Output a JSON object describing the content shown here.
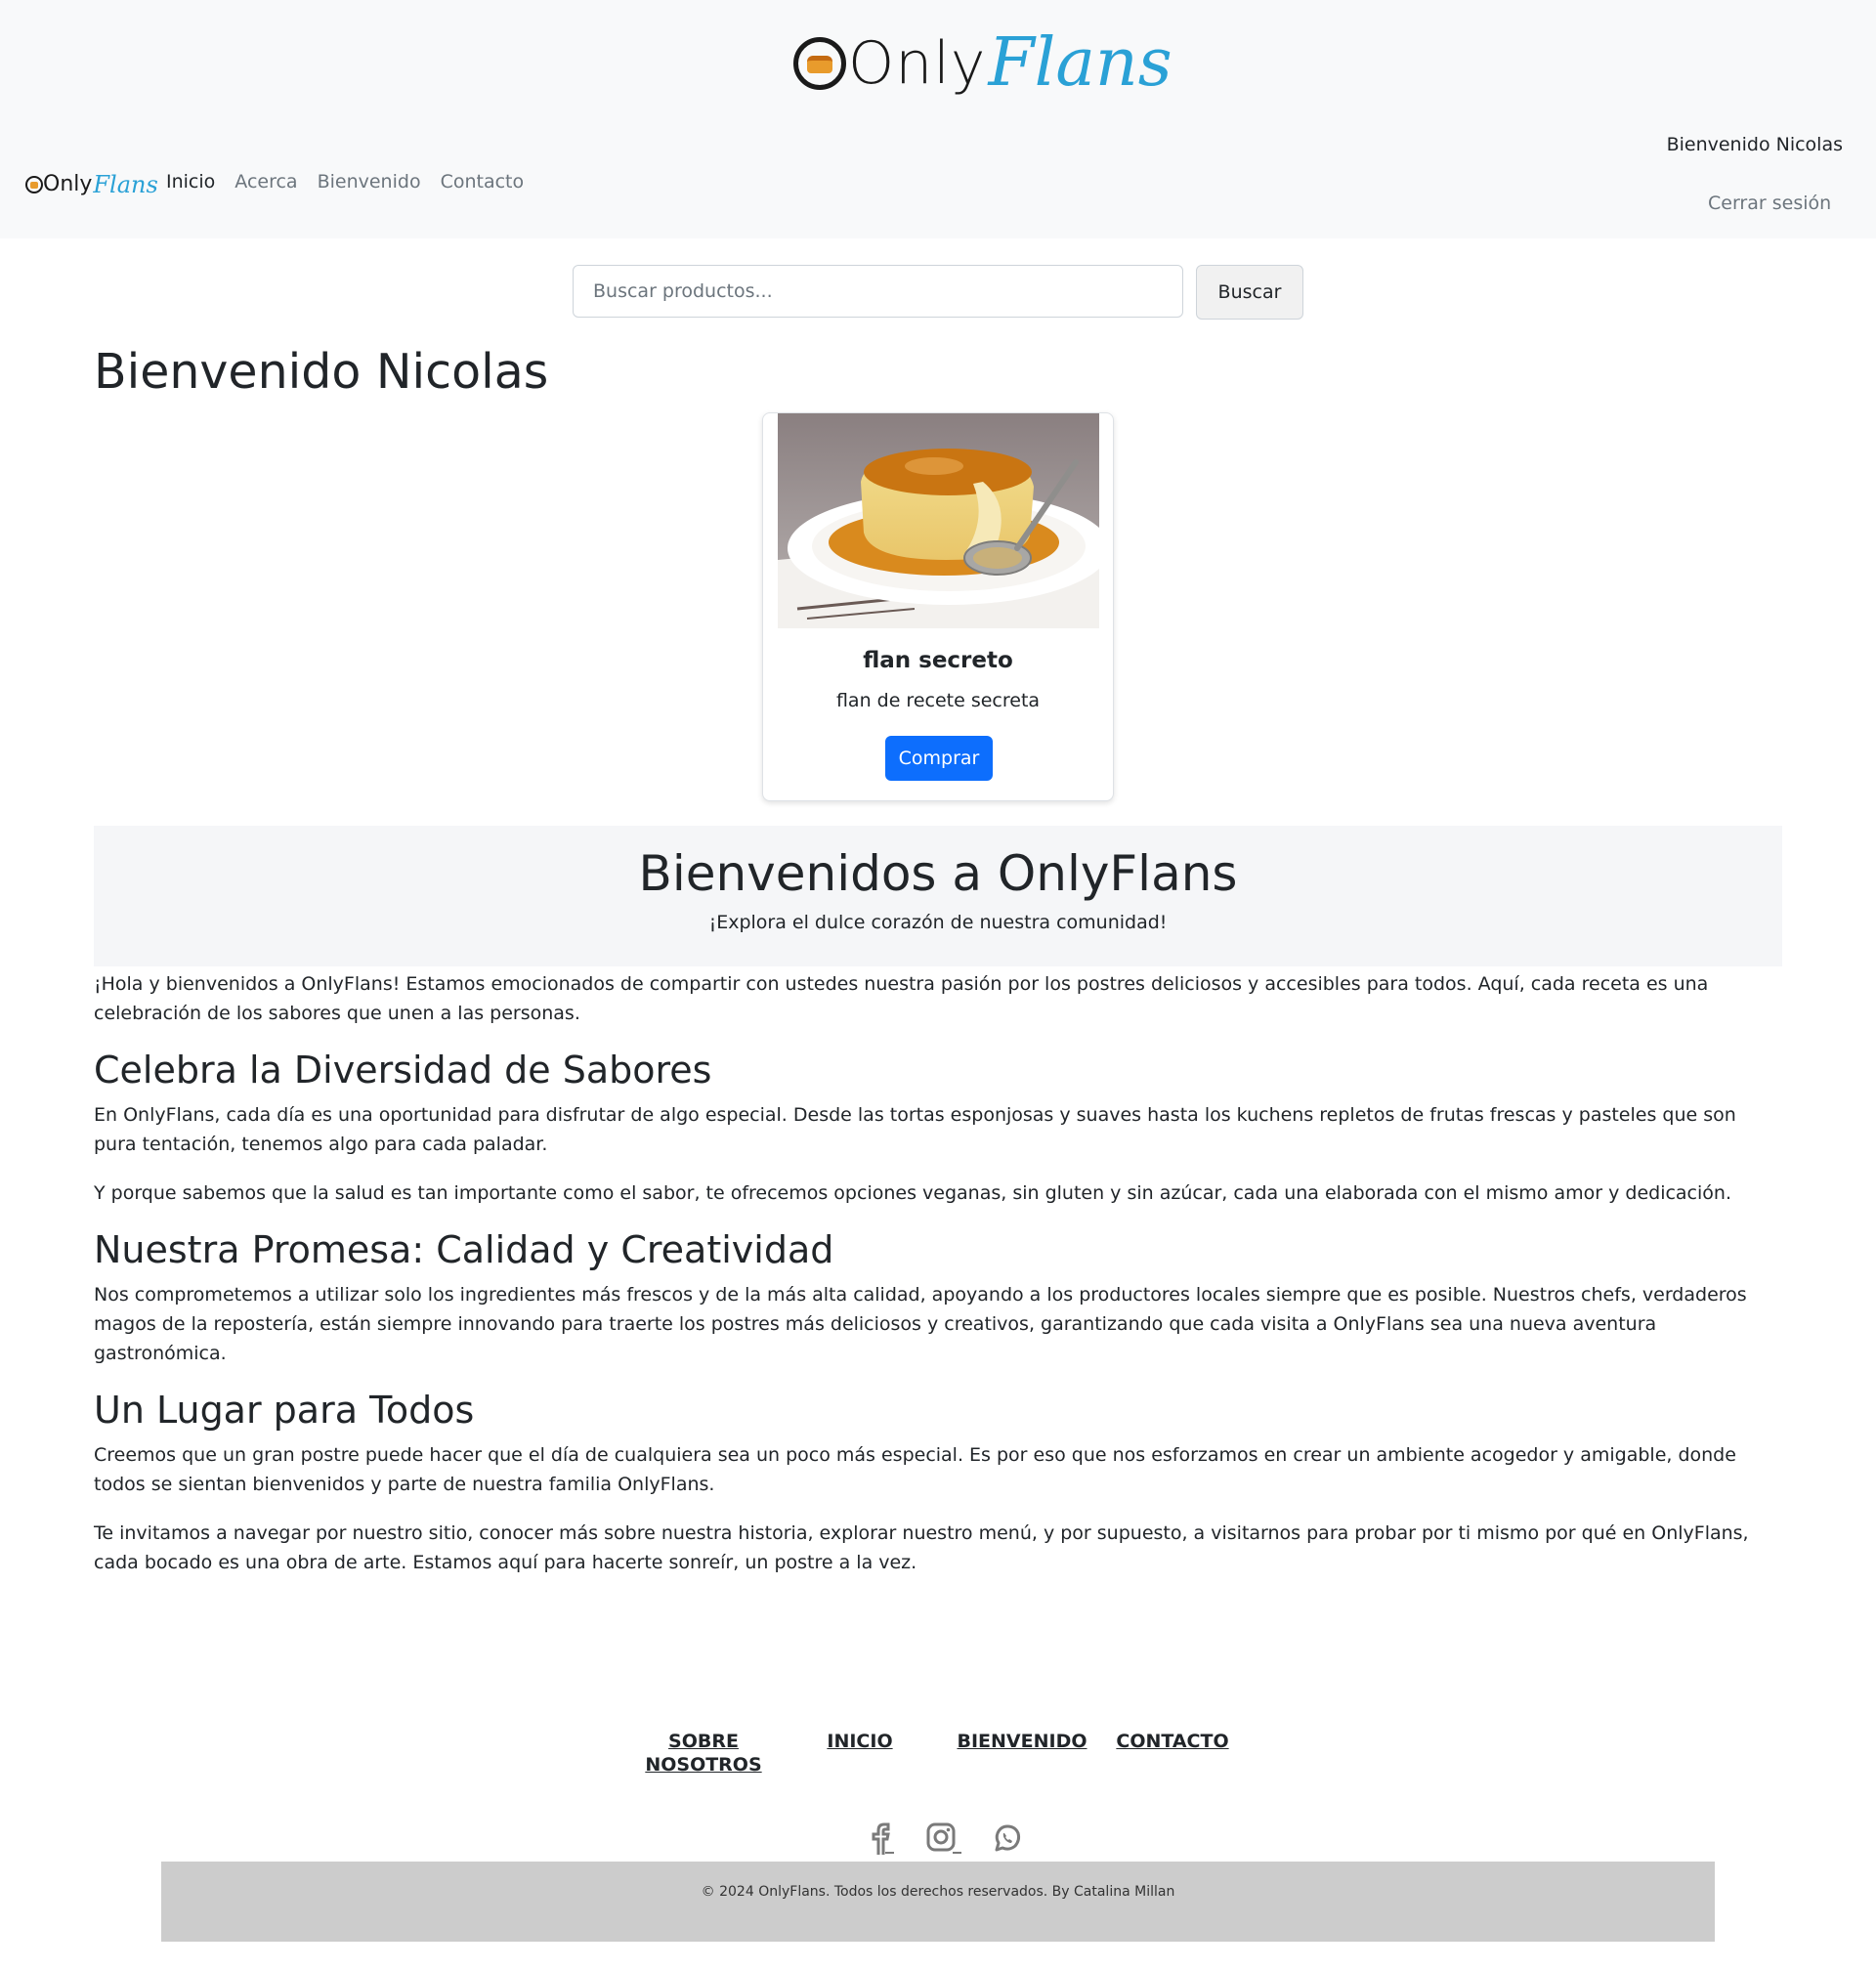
{
  "brand": {
    "part1": "Only",
    "part2": "Flans"
  },
  "nav": {
    "items": [
      {
        "label": "Inicio",
        "active": true
      },
      {
        "label": "Acerca"
      },
      {
        "label": "Bienvenido"
      },
      {
        "label": "Contacto"
      }
    ]
  },
  "user": {
    "greeting": "Bienvenido Nicolas",
    "logout": "Cerrar sesión"
  },
  "search": {
    "placeholder": "Buscar productos...",
    "button": "Buscar"
  },
  "page": {
    "title": "Bienvenido Nicolas"
  },
  "product": {
    "title": "flan secreto",
    "description": "flan de recete secreta",
    "button": "Comprar",
    "image": "flan-photo"
  },
  "hero": {
    "title": "Bienvenidos a OnlyFlans",
    "subtitle": "¡Explora el dulce corazón de nuestra comunidad!"
  },
  "content": {
    "intro": "¡Hola y bienvenidos a OnlyFlans! Estamos emocionados de compartir con ustedes nuestra pasión por los postres deliciosos y accesibles para todos. Aquí, cada receta es una celebración de los sabores que unen a las personas.",
    "section1_title": "Celebra la Diversidad de Sabores",
    "section1_p1": "En OnlyFlans, cada día es una oportunidad para disfrutar de algo especial. Desde las tortas esponjosas y suaves hasta los kuchens repletos de frutas frescas y pasteles que son pura tentación, tenemos algo para cada paladar.",
    "section1_p2": "Y porque sabemos que la salud es tan importante como el sabor, te ofrecemos opciones veganas, sin gluten y sin azúcar, cada una elaborada con el mismo amor y dedicación.",
    "section2_title": "Nuestra Promesa: Calidad y Creatividad",
    "section2_p1": "Nos comprometemos a utilizar solo los ingredientes más frescos y de la más alta calidad, apoyando a los productores locales siempre que es posible. Nuestros chefs, verdaderos magos de la repostería, están siempre innovando para traerte los postres más deliciosos y creativos, garantizando que cada visita a OnlyFlans sea una nueva aventura gastronómica.",
    "section3_title": "Un Lugar para Todos",
    "section3_p1": "Creemos que un gran postre puede hacer que el día de cualquiera sea un poco más especial. Es por eso que nos esforzamos en crear un ambiente acogedor y amigable, donde todos se sientan bienvenidos y parte de nuestra familia OnlyFlans.",
    "section3_p2": "Te invitamos a navegar por nuestro sitio, conocer más sobre nuestra historia, explorar nuestro menú, y por supuesto, a visitarnos para probar por ti mismo por qué en OnlyFlans, cada bocado es una obra de arte. Estamos aquí para hacerte sonreír, un postre a la vez."
  },
  "footer": {
    "links": [
      "SOBRE NOSOTROS",
      "INICIO",
      "BIENVENIDO",
      "CONTACTO"
    ],
    "social": [
      "facebook-icon",
      "instagram-icon",
      "whatsapp-icon"
    ],
    "copyright": "© 2024 OnlyFlans. Todos los derechos reservados. By Catalina Millan"
  }
}
